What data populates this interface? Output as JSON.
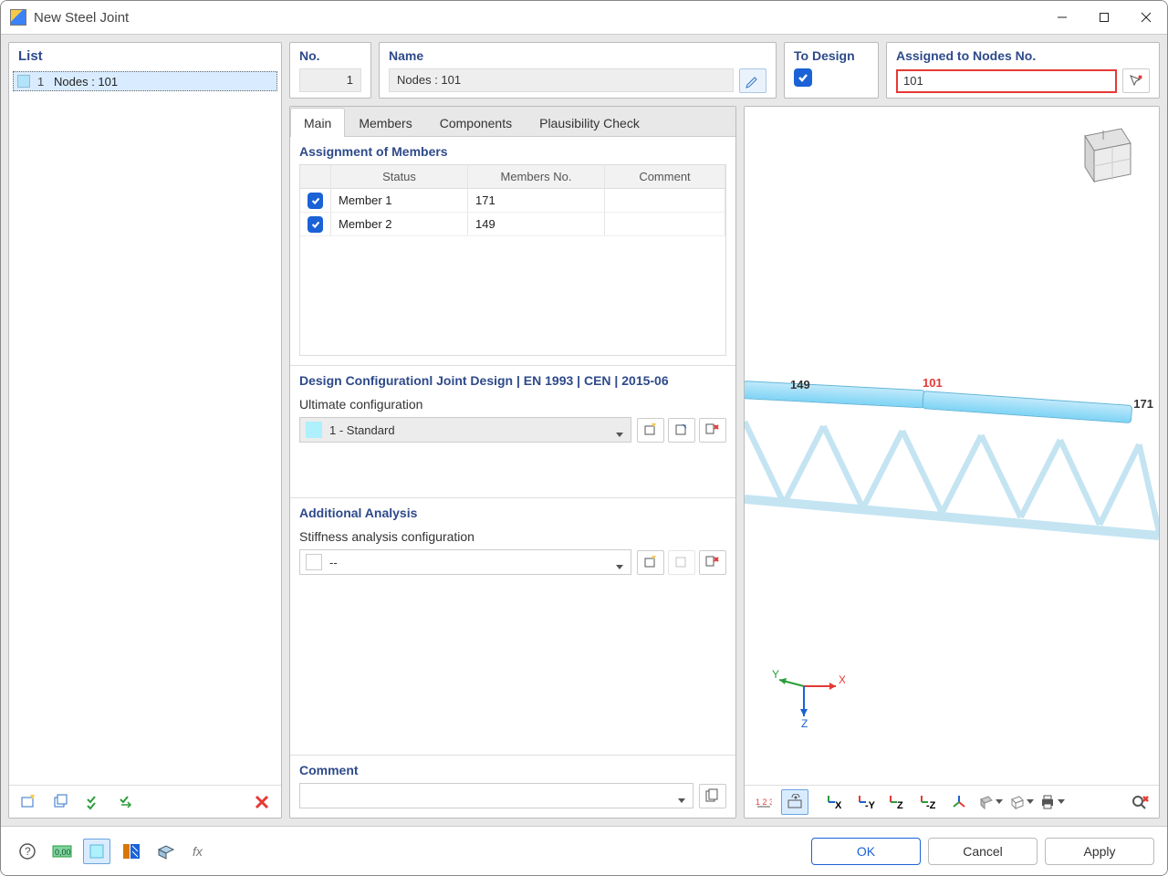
{
  "title": "New Steel Joint",
  "list_panel": {
    "header": "List",
    "items": [
      {
        "index": "1",
        "label": "Nodes : 101"
      }
    ]
  },
  "header_fields": {
    "no": {
      "label": "No.",
      "value": "1"
    },
    "name": {
      "label": "Name",
      "value": "Nodes : 101"
    },
    "to_design": {
      "label": "To Design",
      "checked": true
    },
    "assigned": {
      "label": "Assigned to Nodes No.",
      "value": "101"
    }
  },
  "tabs": [
    "Main",
    "Members",
    "Components",
    "Plausibility Check"
  ],
  "active_tab": 0,
  "assignment": {
    "title": "Assignment of Members",
    "columns": {
      "status": "Status",
      "members_no": "Members No.",
      "comment": "Comment"
    },
    "rows": [
      {
        "checked": true,
        "status": "Member 1",
        "members_no": "171",
        "comment": ""
      },
      {
        "checked": true,
        "status": "Member 2",
        "members_no": "149",
        "comment": ""
      }
    ]
  },
  "design_config": {
    "title": "Design Configurationl Joint Design | EN 1993 | CEN | 2015-06",
    "ultimate_label": "Ultimate configuration",
    "ultimate_value": "1 - Standard"
  },
  "additional": {
    "title": "Additional Analysis",
    "stiffness_label": "Stiffness analysis configuration",
    "stiffness_value": "--"
  },
  "comment_section": {
    "title": "Comment",
    "value": ""
  },
  "view_labels": {
    "node_main": "101",
    "member_left": "149",
    "member_right": "171"
  },
  "axes": {
    "x": "X",
    "y": "Y",
    "z": "Z"
  },
  "buttons": {
    "ok": "OK",
    "cancel": "Cancel",
    "apply": "Apply"
  }
}
